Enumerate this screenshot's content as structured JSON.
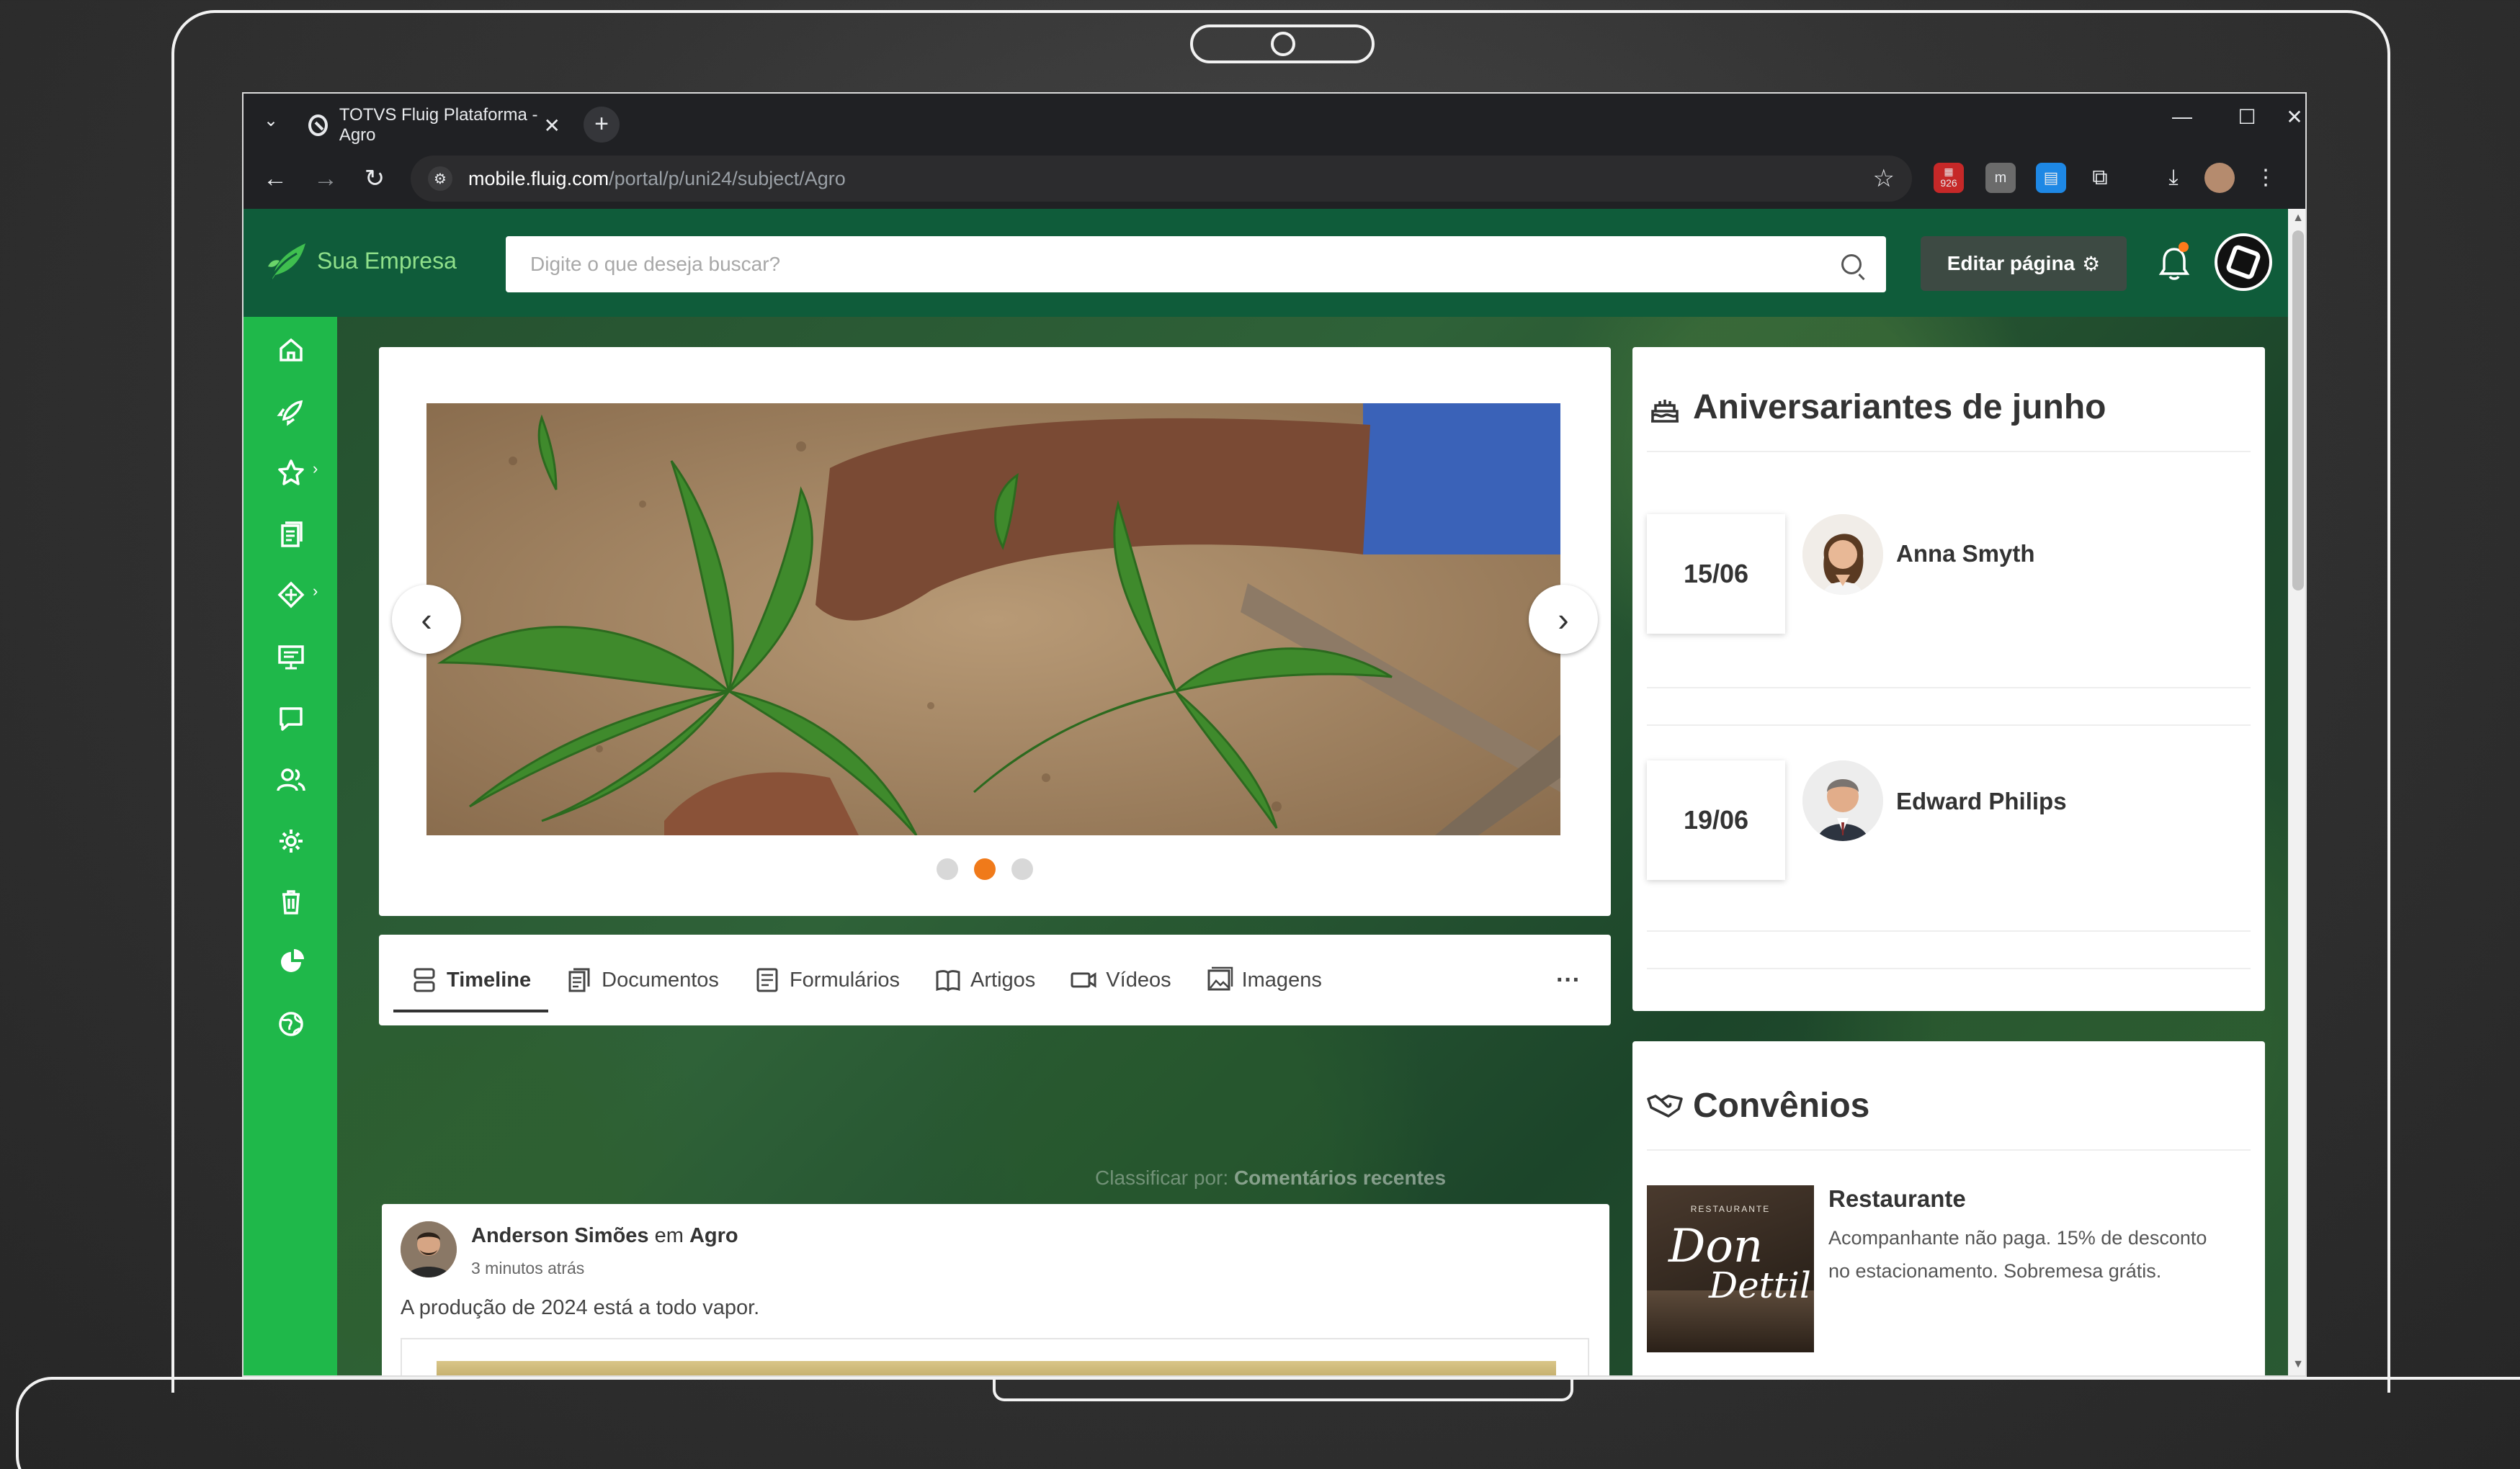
{
  "browser": {
    "tab_title": "TOTVS Fluig Plataforma - Agro",
    "tab_close": "✕",
    "new_tab": "+",
    "url_host": "mobile.fluig.com",
    "url_path": "/portal/p/uni24/subject/Agro",
    "extension_badge": "926"
  },
  "header": {
    "logo_text": "Sua Empresa",
    "search_placeholder": "Digite o que deseja buscar?",
    "edit_button": "Editar página"
  },
  "carousel": {
    "prev": "‹",
    "next": "›",
    "active_slide": 2,
    "slide_count": 3
  },
  "tabs": [
    {
      "label": "Timeline",
      "icon": "timeline-icon"
    },
    {
      "label": "Documentos",
      "icon": "documents-icon"
    },
    {
      "label": "Formulários",
      "icon": "forms-icon"
    },
    {
      "label": "Artigos",
      "icon": "book-icon"
    },
    {
      "label": "Vídeos",
      "icon": "video-icon"
    },
    {
      "label": "Imagens",
      "icon": "image-icon"
    }
  ],
  "tabs_more": "···",
  "sort": {
    "prefix": "Classificar por:",
    "value": "Comentários recentes"
  },
  "post": {
    "author": "Anderson Simões",
    "connector": "em",
    "community": "Agro",
    "time": "3 minutos atrás",
    "text": "A produção de 2024 está a todo vapor."
  },
  "birthdays": {
    "title": "Aniversariantes de junho",
    "people": [
      {
        "date": "15/06",
        "name": "Anna Smyth"
      },
      {
        "date": "19/06",
        "name": "Edward Philips"
      }
    ]
  },
  "agreements": {
    "title": "Convênios",
    "item_title": "Restaurante",
    "item_desc": "Acompanhante não paga. 15% de desconto no estacionamento. Sobremesa grátis.",
    "logo_small": "RESTAURANTE",
    "logo_line1": "Don",
    "logo_line2": "Dettil"
  },
  "colors": {
    "header": "#0f5c3a",
    "sidebar": "#1fb84a",
    "accent": "#f07a1a"
  }
}
